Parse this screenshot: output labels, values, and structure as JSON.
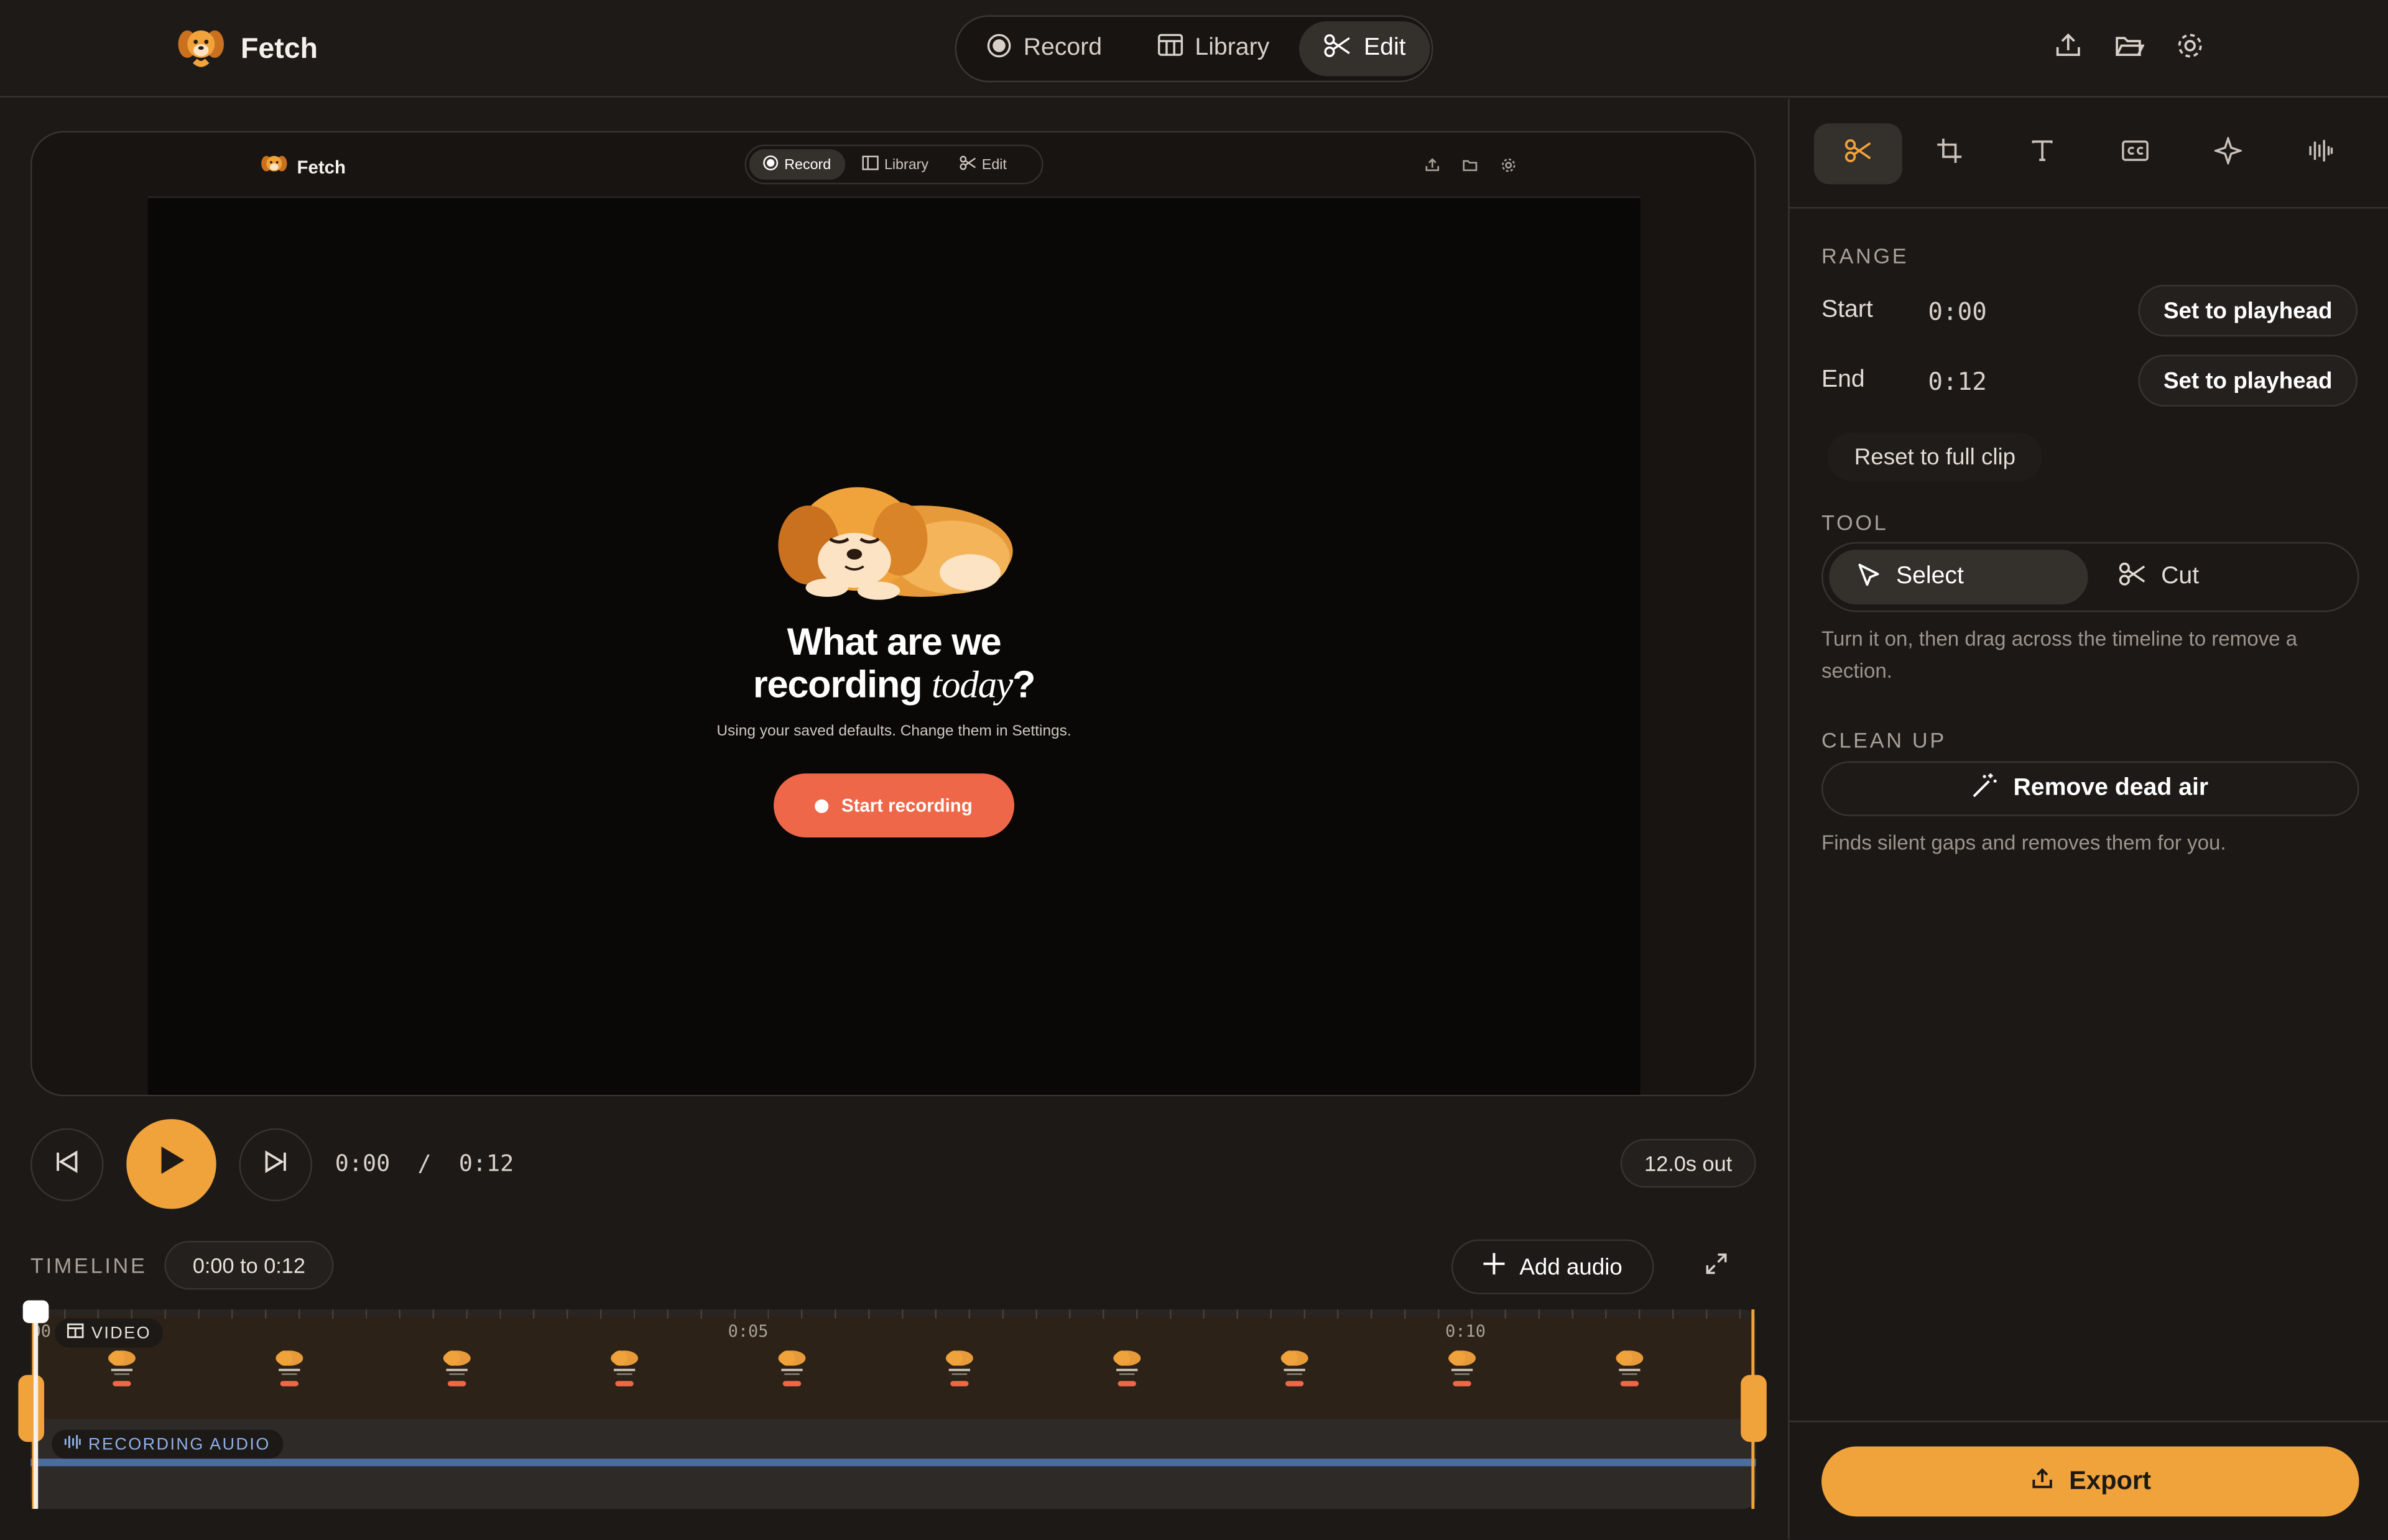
{
  "app": {
    "name": "Fetch"
  },
  "nav": {
    "tabs": [
      {
        "label": "Record",
        "icon": "record-icon"
      },
      {
        "label": "Library",
        "icon": "library-icon"
      },
      {
        "label": "Edit",
        "icon": "scissors-icon",
        "active": true
      }
    ],
    "actions": [
      "export-icon",
      "folder-icon",
      "gear-icon"
    ]
  },
  "preview": {
    "mini_app_name": "Fetch",
    "mini_tabs": [
      "Record",
      "Library",
      "Edit"
    ],
    "title_line1": "What are we",
    "title_line2_start": "recording",
    "title_line2_em": "today",
    "title_line2_end": "?",
    "subtitle": "Using your saved defaults. Change them in Settings.",
    "button": "Start recording"
  },
  "transport": {
    "timecode": "0:00  /  0:12",
    "out_badge": "12.0s out"
  },
  "timeline": {
    "label": "TIMELINE",
    "range": "0:00 to 0:12",
    "add_audio": "Add audio",
    "ticks": [
      "0:00",
      "0:05",
      "0:10"
    ],
    "video_track": "VIDEO",
    "audio_track": "RECORDING AUDIO"
  },
  "panel": {
    "tool_tabs": [
      "scissors-icon",
      "crop-icon",
      "text-icon",
      "captions-icon",
      "sparkle-icon",
      "waveform-icon"
    ],
    "range_title": "RANGE",
    "start_label": "Start",
    "start_time": "0:00",
    "end_label": "End",
    "end_time": "0:12",
    "set_playhead": "Set to playhead",
    "reset": "Reset to full clip",
    "tool_title": "TOOL",
    "tool_select": "Select",
    "tool_cut": "Cut",
    "tool_hint": "Turn it on, then drag across the timeline to remove a section.",
    "cleanup_title": "CLEAN UP",
    "remove_dead_air": "Remove dead air",
    "cleanup_hint": "Finds silent gaps and removes them for you.",
    "export": "Export"
  },
  "colors": {
    "accent": "#f0a23b",
    "record": "#ef6749",
    "audio": "#4d6c9e"
  }
}
